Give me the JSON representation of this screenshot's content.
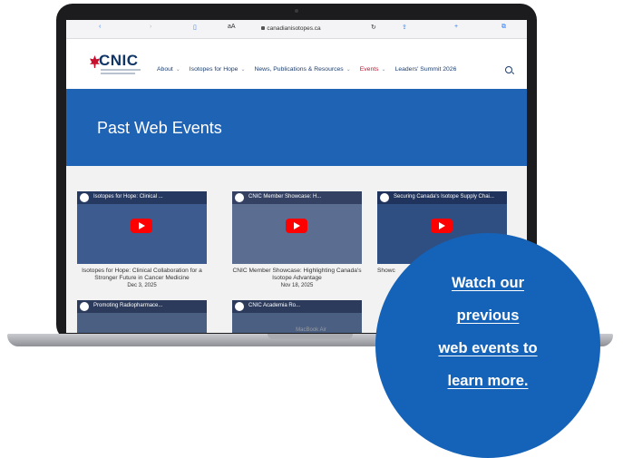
{
  "browser": {
    "url": "canadianisotopes.ca",
    "reader_label": "aA"
  },
  "site": {
    "logo_text": "CNIC",
    "nav": [
      {
        "label": "About",
        "active": false
      },
      {
        "label": "Isotopes for Hope",
        "active": false
      },
      {
        "label": "News, Publications & Resources",
        "active": false
      },
      {
        "label": "Events",
        "active": true
      },
      {
        "label": "Leaders' Summit 2026",
        "active": false
      }
    ],
    "chevron": "⌄"
  },
  "hero": {
    "title": "Past Web Events"
  },
  "videos": [
    {
      "thumb_title": "Isotopes for Hope: Clinical ...",
      "title": "Isotopes for Hope: Clinical Collaboration for a Stronger Future in Cancer Medicine",
      "date": "Dec 3, 2025"
    },
    {
      "thumb_title": "CNIC Member Showcase: H...",
      "title": "CNIC Member Showcase: Highlighting Canada's Isotope Advantage",
      "date": "Nov 18, 2025"
    },
    {
      "thumb_title": "Securing Canada's Isotope Supply Chai...",
      "title": "Showc",
      "date": ""
    }
  ],
  "second_row": [
    {
      "thumb_title": "Promoting Radiopharmace..."
    },
    {
      "thumb_title": "CNIC Academia Ro..."
    }
  ],
  "device_label": "MacBook Air",
  "cta": {
    "lines": [
      "Watch our",
      "previous",
      "web events to",
      "learn more."
    ]
  },
  "colors": {
    "brand_blue": "#1563b8",
    "hero_blue": "#1f63b5",
    "accent_red": "#c8102e",
    "navy": "#0f3566"
  }
}
